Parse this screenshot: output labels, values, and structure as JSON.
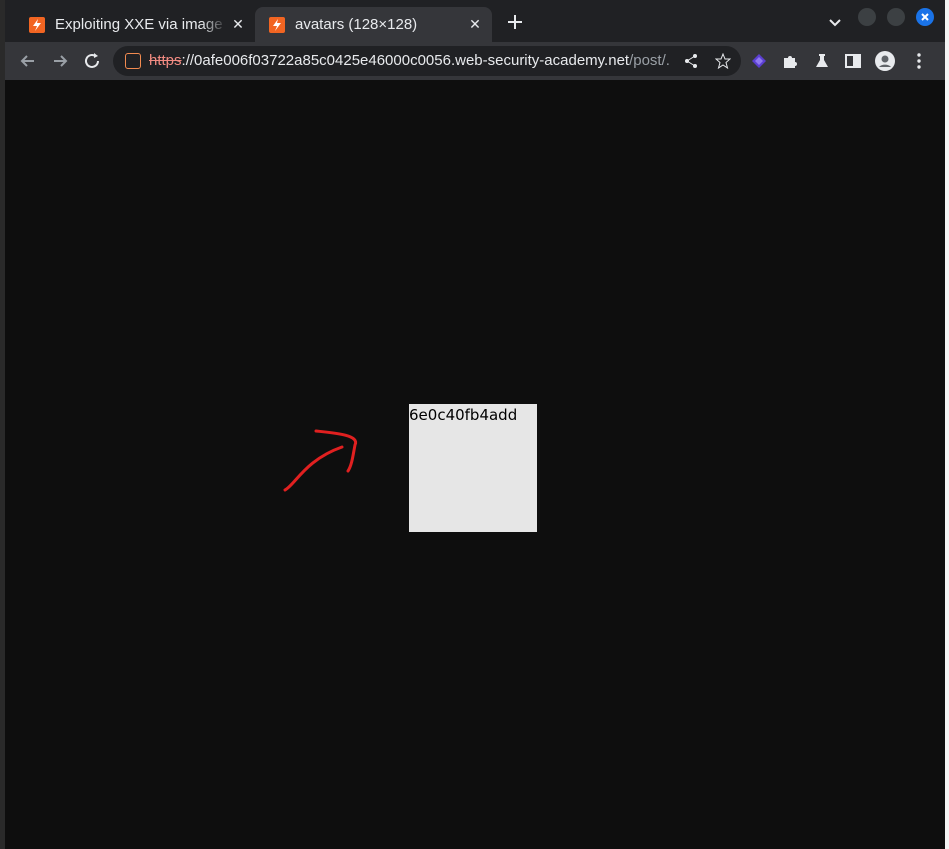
{
  "tabs": [
    {
      "title": "Exploiting XXE via image f",
      "active": false
    },
    {
      "title": "avatars (128×128)",
      "active": true
    }
  ],
  "address_bar": {
    "scheme": "https",
    "host": "://0afe006f03722a85c0425e46000c0056.web-security-academy.net",
    "path": "/post/..."
  },
  "content": {
    "avatar_text": "6e0c40fb4add"
  },
  "colors": {
    "favicon": "#f26522",
    "annotation": "#e02020",
    "page_bg": "#0e0e0e",
    "window_close": "#1a73e8"
  },
  "icons": [
    "back-icon",
    "forward-icon",
    "reload-icon",
    "share-icon",
    "star-icon",
    "extension-icon",
    "puzzle-icon",
    "lab-icon",
    "sidepanel-icon",
    "profile-icon",
    "menu-icon",
    "plus-icon",
    "chevron-down-icon"
  ]
}
